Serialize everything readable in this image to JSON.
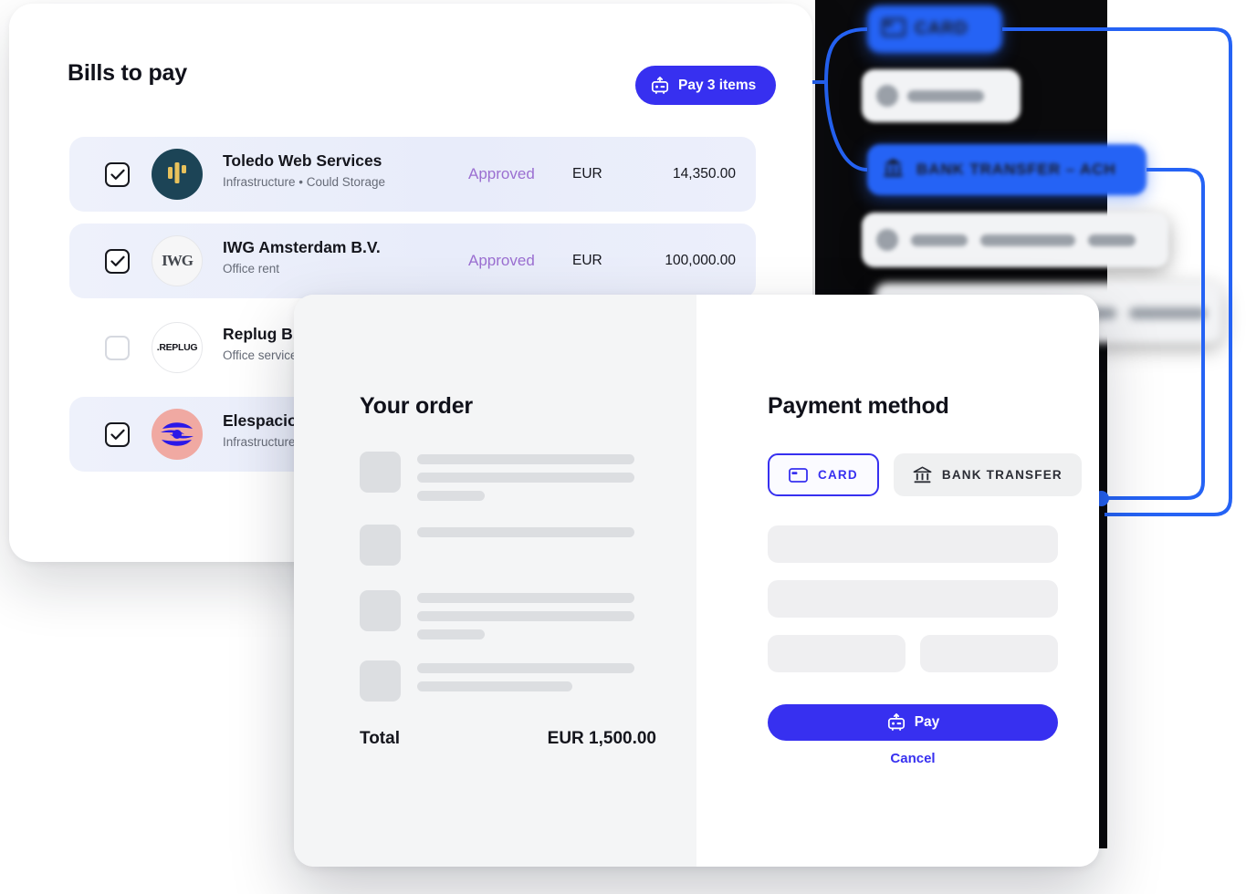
{
  "colors": {
    "brand_indigo": "#3730f0",
    "flow_blue": "#2563f5",
    "status_purple": "#9b6fd1",
    "dark_panel": "#0a0a0c",
    "row_selected": "#e9edfa",
    "skeleton": "#dcdee1"
  },
  "bills_card": {
    "title": "Bills to pay",
    "pay_button": {
      "label": "Pay 3 items",
      "icon": "robot-pay-icon"
    },
    "rows": [
      {
        "checked": true,
        "name": "Toledo Web Services",
        "subtitle": "Infrastructure • Could Storage",
        "status": "Approved",
        "currency": "EUR",
        "amount": "14,350.00",
        "logo": "toledo-logo"
      },
      {
        "checked": true,
        "name": "IWG Amsterdam B.V.",
        "subtitle": "Office rent",
        "status": "Approved",
        "currency": "EUR",
        "amount": "100,000.00",
        "logo": "iwg-logo"
      },
      {
        "checked": false,
        "name": "Replug B.V.",
        "subtitle": "Office services",
        "status": "",
        "currency": "",
        "amount": "",
        "logo": "replug-logo"
      },
      {
        "checked": true,
        "name": "Elespacio",
        "subtitle": "Infrastructure",
        "status": "",
        "currency": "",
        "amount": "",
        "logo": "elespacio-logo"
      }
    ]
  },
  "checkout": {
    "order": {
      "title": "Your order",
      "total_label": "Total",
      "total_value": "EUR 1,500.00",
      "skeleton_rows": [
        {
          "lines": [
            238,
            238,
            74
          ]
        },
        {
          "lines": [
            238
          ]
        },
        {
          "lines": [
            238,
            238,
            74
          ]
        },
        {
          "lines": [
            238,
            170
          ]
        }
      ]
    },
    "payment": {
      "title": "Payment method",
      "methods": [
        {
          "label": "CARD",
          "icon": "credit-card-icon",
          "selected": true
        },
        {
          "label": "BANK TRANSFER",
          "icon": "bank-icon",
          "selected": false
        }
      ],
      "pay_button": {
        "label": "Pay",
        "icon": "robot-pay-icon"
      },
      "cancel_button": {
        "label": "Cancel"
      }
    }
  },
  "automation_panel": {
    "chips": [
      {
        "id": "chip-card",
        "label": "CARD",
        "style": "blue",
        "blur": "heavy",
        "icon": "credit-card-icon"
      },
      {
        "id": "chip-obscured-1",
        "label": "",
        "style": "white",
        "blur": "medium",
        "icon": "dot-icon"
      },
      {
        "id": "chip-bank-transfer-ach",
        "label": "BANK TRANSFER – ACH",
        "style": "blue",
        "blur": "light",
        "icon": "bank-icon"
      },
      {
        "id": "chip-obscured-2",
        "label": "",
        "style": "white",
        "blur": "medium",
        "icon": "dot-icon"
      },
      {
        "id": "chip-obscured-3",
        "label": "",
        "style": "white",
        "blur": "heavy",
        "icon": "warning-icon"
      }
    ]
  }
}
